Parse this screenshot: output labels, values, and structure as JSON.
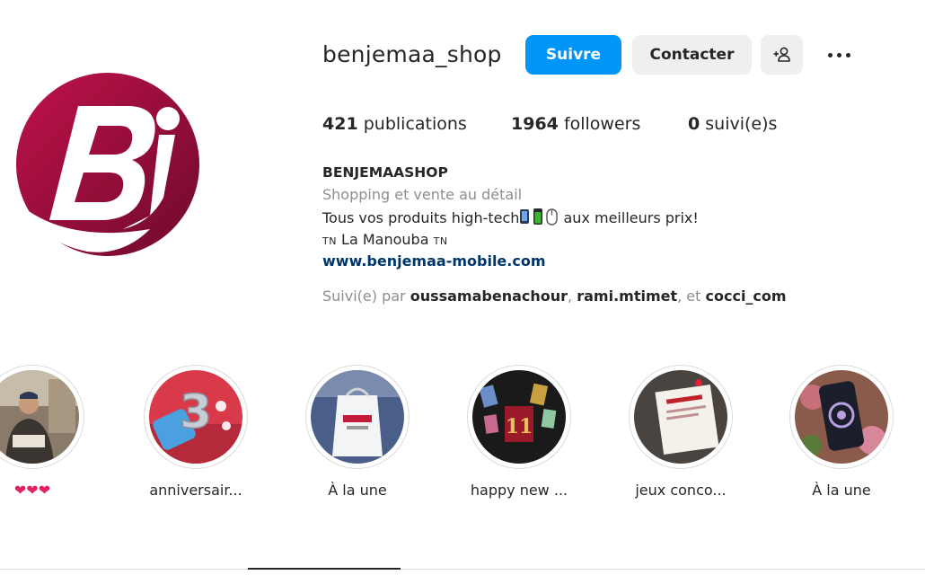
{
  "profile": {
    "username": "benjemaa_shop",
    "follow_label": "Suivre",
    "contact_label": "Contacter",
    "suggest_icon": "add-person-icon",
    "more_icon": "more-options-icon"
  },
  "stats": {
    "posts_count": "421",
    "posts_label": "publications",
    "followers_count": "1964",
    "followers_label": "followers",
    "following_count": "0",
    "following_label": "suivi(e)s"
  },
  "bio": {
    "name": "BENJEMAASHOP",
    "category": "Shopping et vente au détail",
    "desc_start": "Tous vos produits high-tech",
    "desc_end": "aux meilleurs prix!",
    "flag_text": "TN",
    "location": "La Manouba",
    "link": "www.benjemaa-mobile.com",
    "followed_prefix": "Suivi(e) par",
    "followed_acct1": "oussamabenachour",
    "followed_acct2": "rami.mtimet",
    "followed_sep": ", ",
    "followed_and": ", et ",
    "followed_acct3": "cocci_com"
  },
  "highlights": [
    {
      "label": "❤❤❤"
    },
    {
      "label": "anniversair..."
    },
    {
      "label": "À la une"
    },
    {
      "label": "happy new ..."
    },
    {
      "label": "jeux conco..."
    },
    {
      "label": "À la une"
    }
  ],
  "colors": {
    "accent": "#0095f6",
    "brand": "#a0103c",
    "link": "#00376b"
  }
}
